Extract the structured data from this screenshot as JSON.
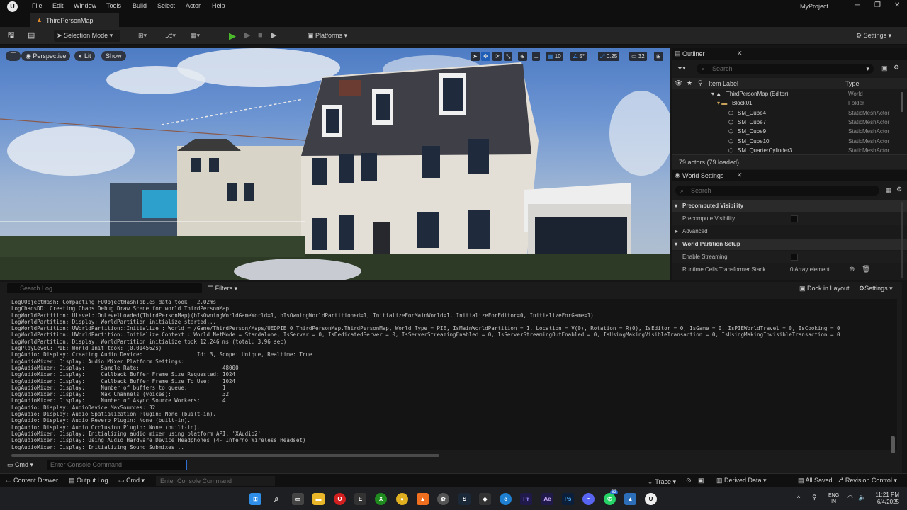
{
  "menu": {
    "items": [
      "File",
      "Edit",
      "Window",
      "Tools",
      "Build",
      "Select",
      "Actor",
      "Help"
    ],
    "project": "MyProject"
  },
  "tab": {
    "title": "ThirdPersonMap"
  },
  "toolbar": {
    "selection_mode": "Selection Mode",
    "platforms": "Platforms",
    "settings": "Settings"
  },
  "viewport": {
    "perspective": "Perspective",
    "lit": "Lit",
    "show": "Show",
    "grid_value": "10",
    "rotation_value": "5°",
    "scale_value": "0.25",
    "camera_speed": "32"
  },
  "outliner": {
    "title": "Outliner",
    "search_placeholder": "Search",
    "col_label": "Item Label",
    "col_type": "Type",
    "rows": [
      {
        "label": "ThirdPersonMap (Editor)",
        "type": "World"
      },
      {
        "label": "Block01",
        "type": "Folder"
      },
      {
        "label": "SM_Cube4",
        "type": "StaticMeshActor"
      },
      {
        "label": "SM_Cube7",
        "type": "StaticMeshActor"
      },
      {
        "label": "SM_Cube9",
        "type": "StaticMeshActor"
      },
      {
        "label": "SM_Cube10",
        "type": "StaticMeshActor"
      },
      {
        "label": "SM_QuarterCylinder3",
        "type": "StaticMeshActor"
      }
    ],
    "status": "79 actors (79 loaded)"
  },
  "world_settings": {
    "title": "World Settings",
    "search_placeholder": "Search",
    "precomputed_visibility": "Precomputed Visibility",
    "precompute_visibility": "Precompute Visibility",
    "advanced": "Advanced",
    "world_partition_setup": "World Partition Setup",
    "enable_streaming": "Enable Streaming",
    "runtime_cells": "Runtime Cells Transformer Stack",
    "array_value": "0 Array element"
  },
  "output_log": {
    "search_placeholder": "Search Log",
    "filters": "Filters",
    "dock": "Dock in Layout",
    "settings": "Settings",
    "lines": [
      "LogUObjectHash: Compacting FUObjectHashTables data took   2.02ms",
      "LogChaosDD: Creating Chaos Debug Draw Scene for world ThirdPersonMap",
      "LogWorldPartition: ULevel::OnLevelLoaded(ThirdPersonMap)(bIsOwningWorldGameWorld=1, bIsOwningWorldPartitioned=1, InitializeForMainWorld=1, InitializeForEditor=0, InitializeForGame=1)",
      "LogWorldPartition: Display: WorldPartition initialize started...",
      "LogWorldPartition: UWorldPartition::Initialize : World = /Game/ThirdPerson/Maps/UEDPIE_0_ThirdPersonMap.ThirdPersonMap, World Type = PIE, IsMainWorldPartition = 1, Location = V(0), Rotation = R(0), IsEditor = 0, IsGame = 0, IsPIEWorldTravel = 0, IsCooking = 0",
      "LogWorldPartition: UWorldPartition::Initialize Context : World NetMode = Standalone, IsServer = 0, IsDedicatedServer = 0, IsServerStreamingEnabled = 0, IsServerStreamingOutEnabled = 0, IsUsingMakingVisibleTransaction = 0, IsUsingMakingInvisibleTransaction = 0",
      "LogWorldPartition: Display: WorldPartition initialize took 12.246 ms (total: 3.96 sec)",
      "LogPlayLevel: PIE: World Init took: (0.014562s)",
      "LogAudio: Display: Creating Audio Device:                 Id: 3, Scope: Unique, Realtime: True",
      "LogAudioMixer: Display: Audio Mixer Platform Settings:",
      "LogAudioMixer: Display:     Sample Rate:                          48000",
      "LogAudioMixer: Display:     Callback Buffer Frame Size Requested: 1024",
      "LogAudioMixer: Display:     Callback Buffer Frame Size To Use:    1024",
      "LogAudioMixer: Display:     Number of buffers to queue:           1",
      "LogAudioMixer: Display:     Max Channels (voices):                32",
      "LogAudioMixer: Display:     Number of Async Source Workers:       4",
      "LogAudio: Display: AudioDevice MaxSources: 32",
      "LogAudio: Display: Audio Spatialization Plugin: None (built-in).",
      "LogAudio: Display: Audio Reverb Plugin: None (built-in).",
      "LogAudio: Display: Audio Occlusion Plugin: None (built-in).",
      "LogAudioMixer: Display: Initializing audio mixer using platform API: 'XAudio2'",
      "LogAudioMixer: Display: Using Audio Hardware Device Headphones (4- Inferno Wireless Headset)",
      "LogAudioMixer: Display: Initializing Sound Submixes..."
    ],
    "cmd_label": "Cmd",
    "cmd_placeholder": "Enter Console Command"
  },
  "statusbar": {
    "content_drawer": "Content Drawer",
    "output_log": "Output Log",
    "cmd": "Cmd",
    "cmd_placeholder": "Enter Console Command",
    "trace": "Trace",
    "derived_data": "Derived Data",
    "all_saved": "All Saved",
    "revision_control": "Revision Control"
  },
  "taskbar": {
    "lang1": "ENG",
    "lang2": "IN",
    "time": "11:21 PM",
    "date": "6/4/2025",
    "badge": "62"
  }
}
